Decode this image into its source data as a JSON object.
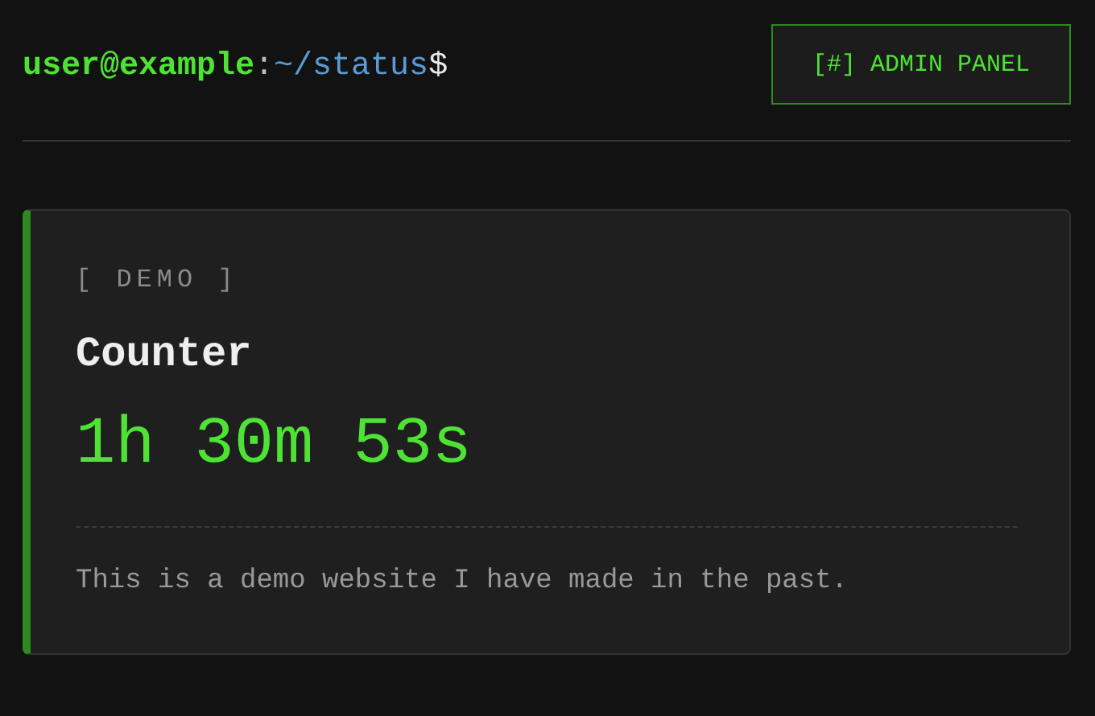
{
  "header": {
    "prompt": {
      "user": "user@example",
      "separator": ":",
      "path": "~/status",
      "symbol": "$"
    },
    "admin_button": "[#] ADMIN PANEL"
  },
  "card": {
    "tag": "[ DEMO ]",
    "title": "Counter",
    "counter": "1h 30m 53s",
    "description": "This is a demo website I have made in the past."
  }
}
